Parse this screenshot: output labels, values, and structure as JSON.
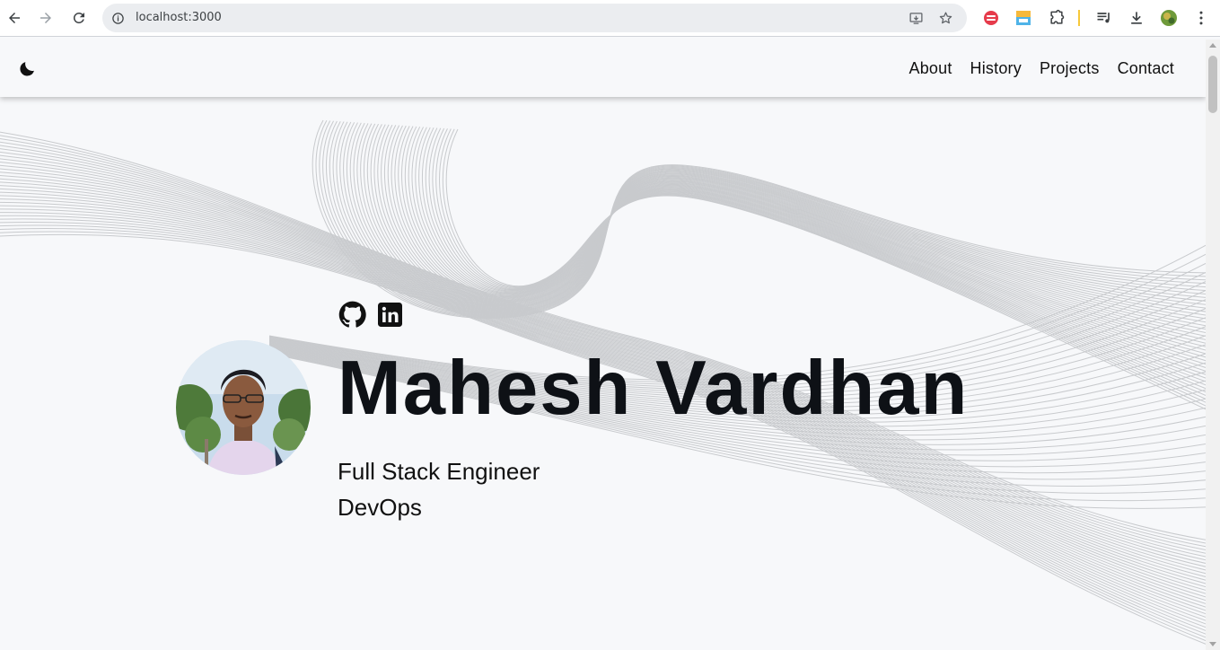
{
  "browser": {
    "url": "localhost:3000",
    "icons": {
      "back": "back-arrow-icon",
      "forward": "forward-arrow-icon",
      "reload": "reload-icon",
      "site_info": "info-icon",
      "install": "install-app-icon",
      "bookmark": "star-icon",
      "extensions": "puzzle-icon",
      "media": "media-controls-icon",
      "downloads": "download-icon",
      "profile": "profile-avatar",
      "menu": "more-vertical-icon"
    }
  },
  "header": {
    "theme_icon": "moon-icon",
    "nav": [
      {
        "label": "About"
      },
      {
        "label": "History"
      },
      {
        "label": "Projects"
      },
      {
        "label": "Contact"
      }
    ]
  },
  "hero": {
    "social": [
      {
        "icon": "github-icon"
      },
      {
        "icon": "linkedin-icon"
      }
    ],
    "name": "Mahesh Vardhan",
    "roles": [
      "Full Stack Engineer",
      "DevOps"
    ]
  },
  "colors": {
    "page_bg": "#f7f8fa",
    "text": "#0e1116",
    "wave": "#c8cacd"
  }
}
